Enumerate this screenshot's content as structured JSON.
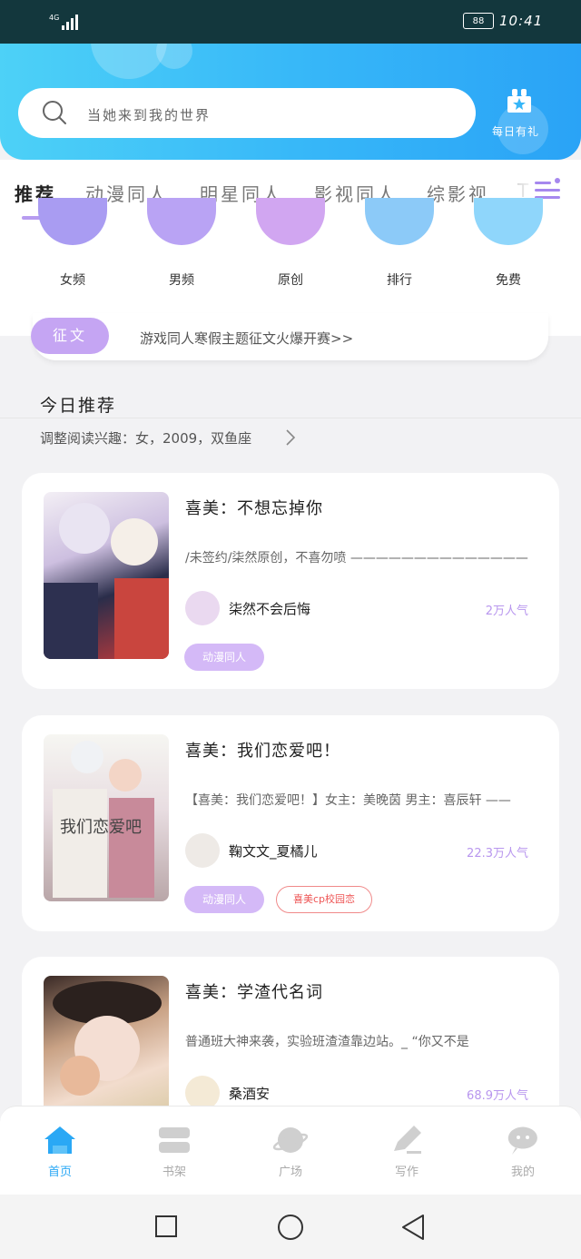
{
  "status_bar": {
    "signal": "4G",
    "battery": "88",
    "time": "10:41"
  },
  "header": {
    "search_placeholder": "当她来到我的世界",
    "daily_gift_label": "每日有礼"
  },
  "tabs": [
    {
      "label": "推荐",
      "active": true
    },
    {
      "label": "动漫同人"
    },
    {
      "label": "明星同人"
    },
    {
      "label": "影视同人"
    },
    {
      "label": "综影视"
    },
    {
      "label": "T"
    }
  ],
  "categories": [
    {
      "label": "女频",
      "color": "#a99cf2"
    },
    {
      "label": "男频",
      "color": "#b9a3f4"
    },
    {
      "label": "原创",
      "color": "#d1a6f1"
    },
    {
      "label": "排行",
      "color": "#8ccaf8"
    },
    {
      "label": "免费",
      "color": "#8fd6fb"
    }
  ],
  "contest": {
    "badge": "征文",
    "text": "游戏同人寒假主题征文火爆开赛>>"
  },
  "today": {
    "title": "今日推荐",
    "preferences": "调整阅读兴趣：女，2009，双鱼座"
  },
  "books": [
    {
      "title": "喜美：不想忘掉你",
      "description": "/未签约/柒然原创，不喜勿喷 ——————————————",
      "author": "柒然不会后悔",
      "popularity": "2万人气",
      "tags": [
        "动漫同人"
      ],
      "outline_tags": []
    },
    {
      "title": "喜美：我们恋爱吧！",
      "description": "【喜美：我们恋爱吧！】女主：美晚茵 男主：喜辰轩 ——",
      "author": "鞠文文_夏橘儿",
      "popularity": "22.3万人气",
      "tags": [
        "动漫同人"
      ],
      "outline_tags": [
        "喜美cp校园恋"
      ]
    },
    {
      "title": "喜美：学渣代名词",
      "description": "普通班大神来袭，实验班渣渣靠边站。_ “你又不是",
      "author": "桑酒安",
      "popularity": "68.9万人气",
      "tags": [],
      "outline_tags": []
    }
  ],
  "bottom_nav": [
    {
      "label": "首页",
      "active": true
    },
    {
      "label": "书架"
    },
    {
      "label": "广场"
    },
    {
      "label": "写作"
    },
    {
      "label": "我的"
    }
  ],
  "colors": {
    "accent": "#2aa8f5",
    "purple": "#c5a5f3",
    "header_start": "#4dd1f7",
    "header_end": "#2aa3f6"
  }
}
